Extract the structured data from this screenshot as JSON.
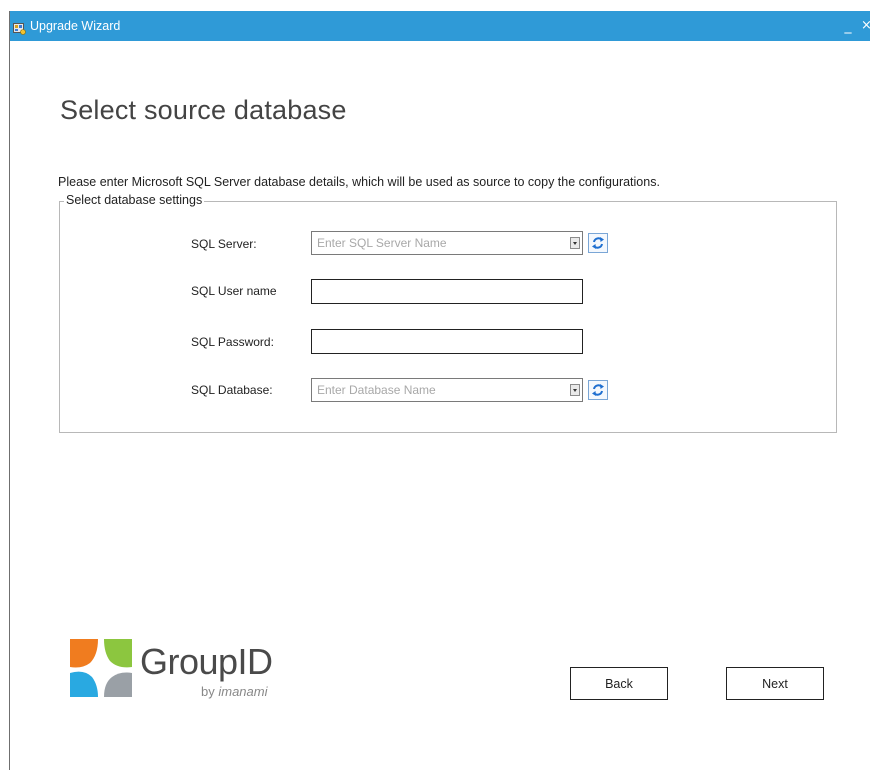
{
  "window": {
    "title": "Upgrade Wizard",
    "minimize_glyph": "_",
    "close_glyph": "×"
  },
  "page": {
    "title": "Select source database",
    "instruction": "Please enter Microsoft SQL Server database details, which will be used as source to copy the configurations."
  },
  "settings": {
    "legend": "Select database settings",
    "sql_server": {
      "label": "SQL Server:",
      "value": "",
      "placeholder": "Enter SQL Server Name"
    },
    "sql_username": {
      "label": "SQL User name",
      "value": ""
    },
    "sql_password": {
      "label": "SQL Password:",
      "value": ""
    },
    "sql_database": {
      "label": "SQL Database:",
      "value": "",
      "placeholder": "Enter Database Name"
    }
  },
  "logo": {
    "name": "GroupID",
    "by": "by",
    "company": "imanami"
  },
  "buttons": {
    "back": "Back",
    "next": "Next"
  },
  "icons": {
    "app": "upgrade-wizard-app-icon",
    "refresh": "refresh-icon",
    "dropdown": "dropdown-arrow-icon"
  },
  "colors": {
    "titlebar": "#2f9ad7",
    "logo_orange": "#f07c1f",
    "logo_green": "#8cc63f",
    "logo_blue": "#29a9e1"
  }
}
